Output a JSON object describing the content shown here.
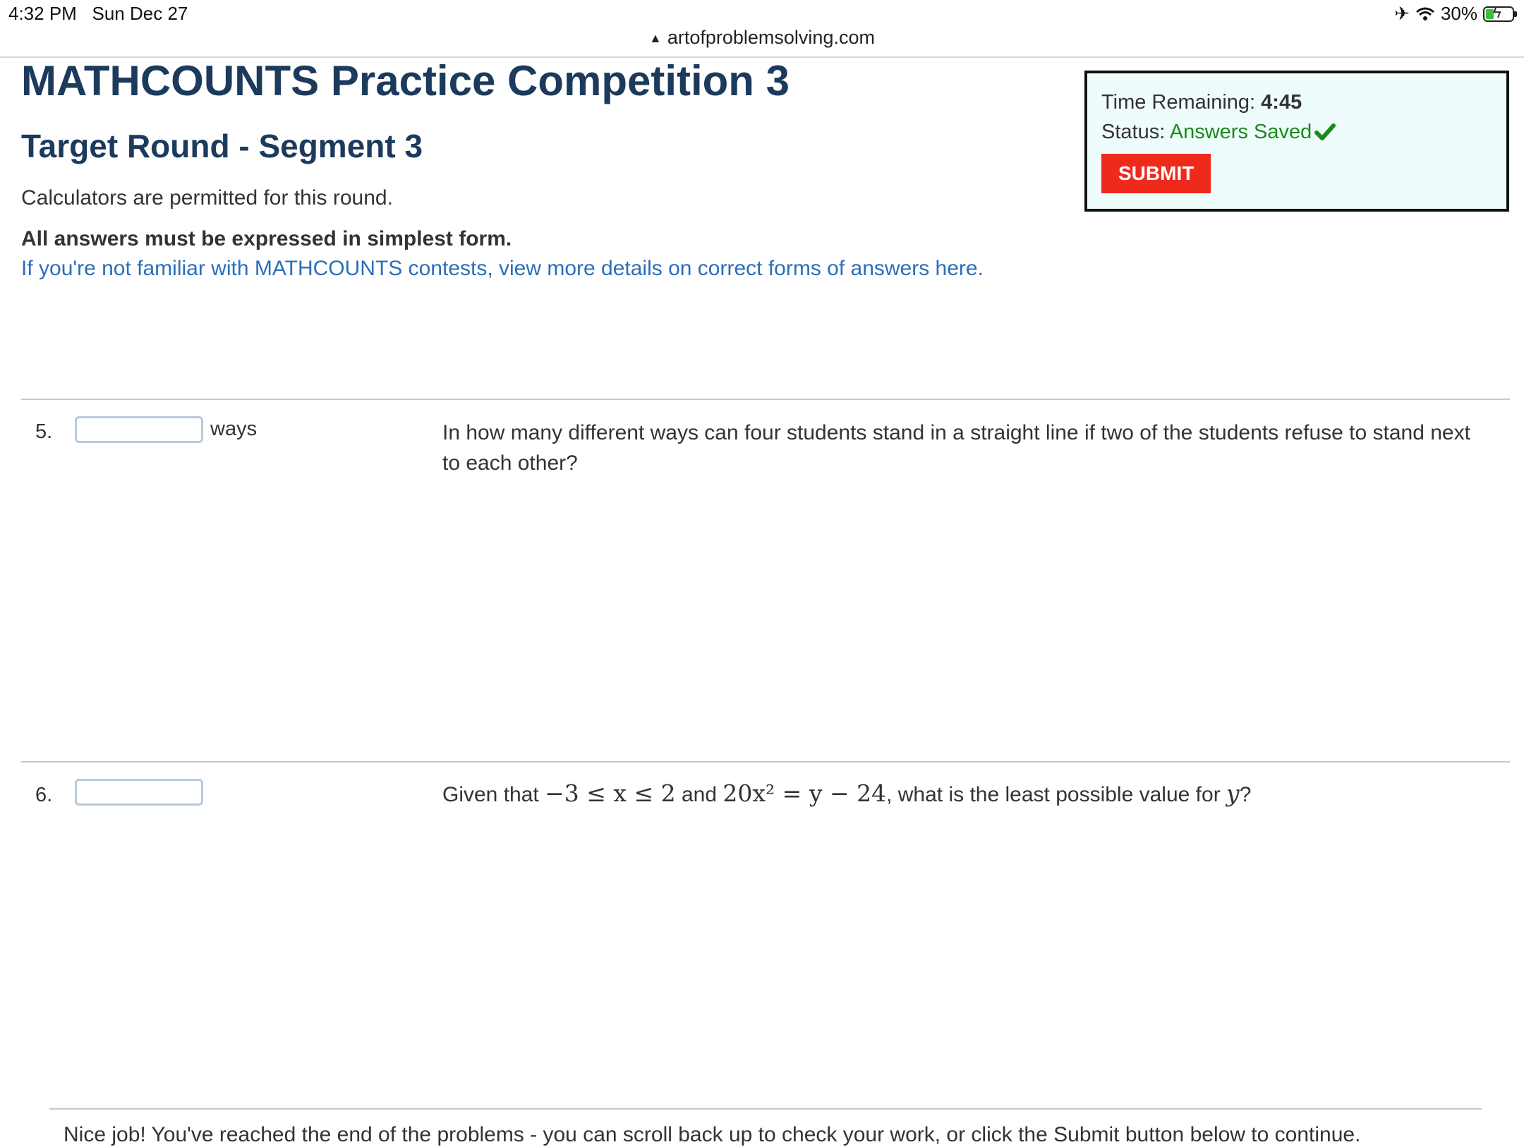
{
  "status_bar": {
    "time": "4:32 PM",
    "date": "Sun Dec 27",
    "battery": "30%",
    "battery_level": 0.3
  },
  "browser": {
    "url": "artofproblemsolving.com"
  },
  "header": {
    "title": "MATHCOUNTS Practice Competition 3",
    "round": "Target Round - Segment 3",
    "calculator_note": "Calculators are permitted for this round.",
    "simplest_form_note": "All answers must be expressed in simplest form.",
    "forms_link": "If you're not familiar with MATHCOUNTS contests, view more details on correct forms of answers here."
  },
  "timer": {
    "time_label": "Time Remaining:",
    "time_value": "4:45",
    "status_label": "Status:",
    "status_value": "Answers Saved",
    "submit_label": "SUBMIT"
  },
  "problems": [
    {
      "number": "5.",
      "answer_value": "",
      "unit": "ways",
      "text": "In how many different ways can four students stand in a straight line if two of the students refuse to stand next to each other?"
    },
    {
      "number": "6.",
      "answer_value": "",
      "unit": "",
      "text_prefix": "Given that",
      "text_middle": "and",
      "text_suffix": ", what is the least possible value for",
      "math_1": "−3 ≤ x ≤ 2",
      "math_2": "20x² = y − 24",
      "math_3": "y",
      "text_end": "?"
    }
  ],
  "footer": {
    "end_note": "Nice job! You've reached the end of the problems - you can scroll back up to check your work, or click the Submit button below to continue."
  },
  "colors": {
    "title": "#1b3a5c",
    "link": "#2a6ebb",
    "submit": "#ee2a1c",
    "saved": "#1a8a1a",
    "timer_bg": "#effcfc"
  }
}
